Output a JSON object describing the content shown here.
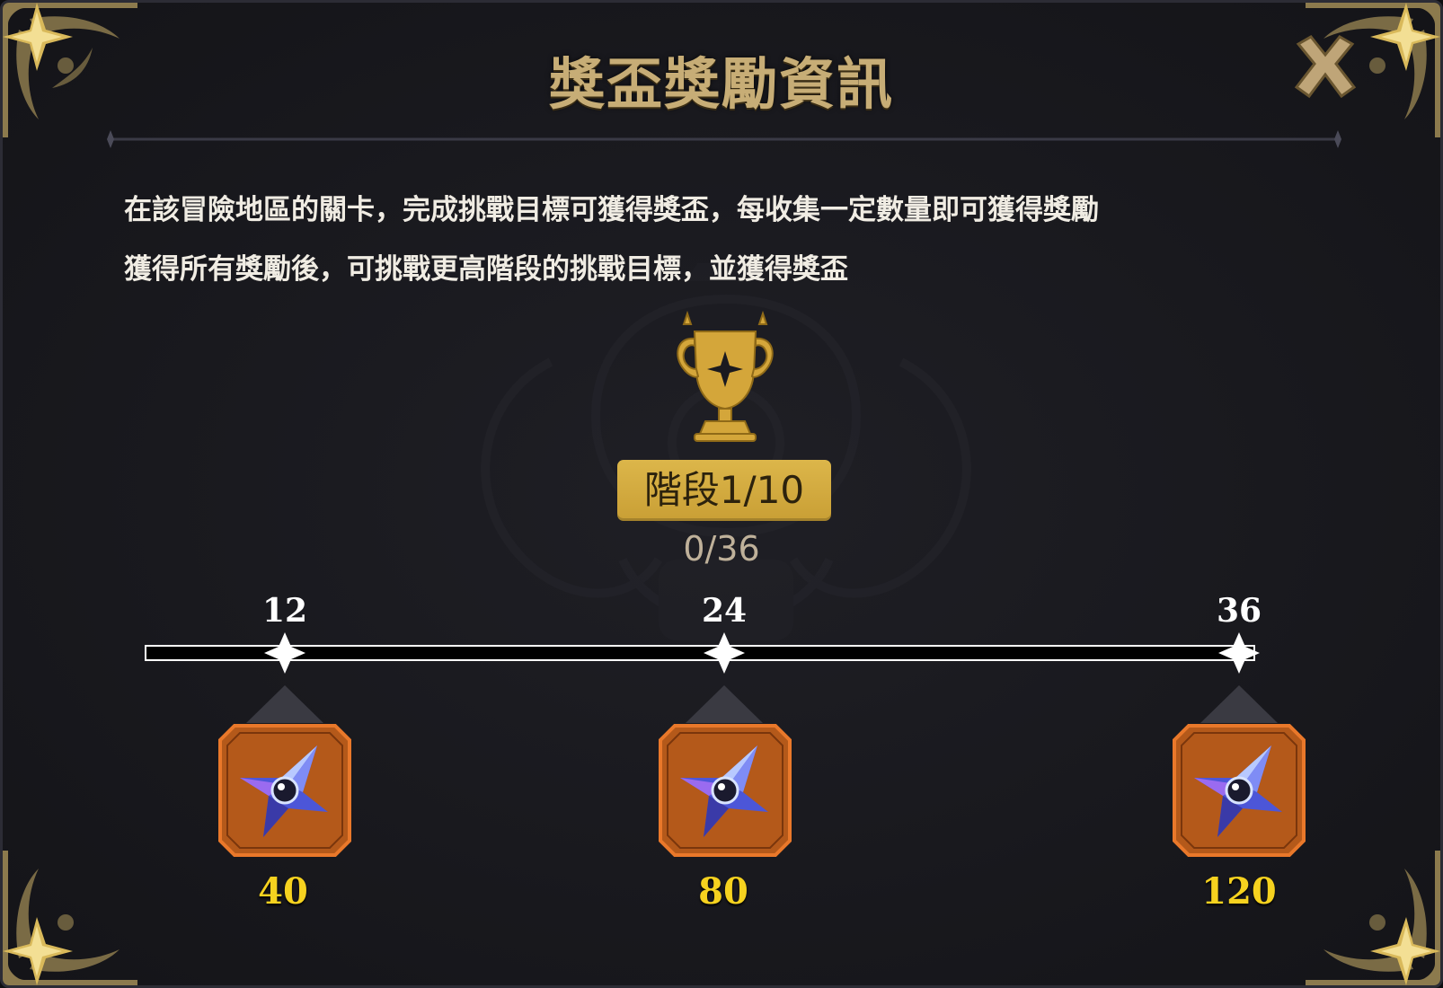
{
  "dialog": {
    "title": "獎盃獎勵資訊",
    "close_icon": "close-icon",
    "description_lines": [
      "在該冒險地區的關卡，完成挑戰目標可獲得獎盃，每收集一定數量即可獲得獎勵",
      "獲得所有獎勵後，可挑戰更高階段的挑戰目標，並獲得獎盃"
    ]
  },
  "stage": {
    "trophy_icon": "trophy-icon",
    "label": "階段1/10",
    "progress_text": "0/36",
    "current": 0,
    "max": 36
  },
  "milestones": [
    {
      "threshold": "12",
      "reward_icon": "crystal-icon",
      "reward_amount": "40"
    },
    {
      "threshold": "24",
      "reward_icon": "crystal-icon",
      "reward_amount": "80"
    },
    {
      "threshold": "36",
      "reward_icon": "crystal-icon",
      "reward_amount": "120"
    }
  ],
  "colors": {
    "background": "#19191e",
    "title_gold": "#c7ad76",
    "badge_gold": "#d4ad40",
    "reward_amount_yellow": "#f6d21f",
    "reward_slot_orange": "#b4591a"
  }
}
